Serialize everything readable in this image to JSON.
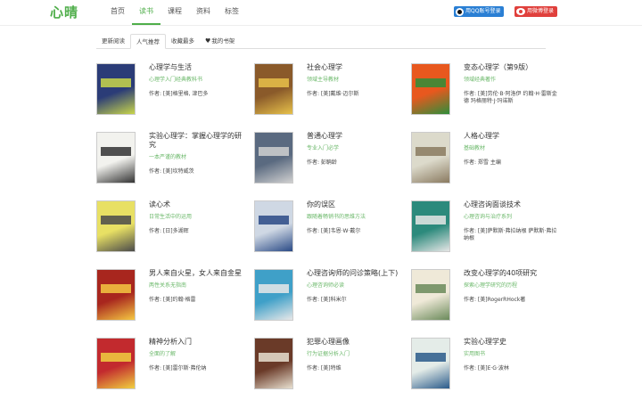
{
  "header": {
    "logo": "心晴",
    "nav": [
      "首页",
      "读书",
      "课程",
      "资料",
      "标签"
    ],
    "active_nav": 1,
    "qq_login": "用QQ账号登录",
    "weibo_login": "用微博登录"
  },
  "tabs": {
    "items": [
      "更新阅读",
      "人气推荐",
      "收藏最多",
      "我的书架"
    ],
    "active": 1
  },
  "books": [
    {
      "title": "心理学与生活",
      "subtitle": "心理学入门经典教科书",
      "author": "作者: [美]格里格, 津巴多",
      "cover": "#2b3c77",
      "accent": "#c9d64a"
    },
    {
      "title": "社会心理学",
      "subtitle": "领域主导教材",
      "author": "作者: [美]戴维·迈尔斯",
      "cover": "#8a5a2a",
      "accent": "#e7c14a"
    },
    {
      "title": "变态心理学（第9版）",
      "subtitle": "领域经典著作",
      "author": "作者: [美]劳伦·B·阿洛伊 约翰·H·雷斯金德 玛格丽特·J·玛诺斯",
      "cover": "#e8581e",
      "accent": "#2e8e3a"
    },
    {
      "title": "实验心理学：掌握心理学的研究",
      "subtitle": "一本严谨的教材",
      "author": "作者: [美]坎特威茨",
      "cover": "#f2f2ee",
      "accent": "#333333"
    },
    {
      "title": "普通心理学",
      "subtitle": "专业入门必学",
      "author": "作者: 彭聃龄",
      "cover": "#5a6a80",
      "accent": "#d0d0d0"
    },
    {
      "title": "人格心理学",
      "subtitle": "基础教材",
      "author": "作者: 郑雪 主编",
      "cover": "#dcdacb",
      "accent": "#8a7a60"
    },
    {
      "title": "读心术",
      "subtitle": "日常生活中的运用",
      "author": "作者: [日]多湖辉",
      "cover": "#e8e064",
      "accent": "#4a4a4a"
    },
    {
      "title": "你的误区",
      "subtitle": "跟随着畅销书的思维方法",
      "author": "作者: [美]韦恩·W·戴尔",
      "cover": "#cfd8e4",
      "accent": "#2a4a86"
    },
    {
      "title": "心理咨询面谈技术",
      "subtitle": "心理咨询与治疗系列",
      "author": "作者: [美]萨默斯·弗拉纳根 萨默斯·弗拉纳根",
      "cover": "#2c8a7c",
      "accent": "#e6e6e6"
    },
    {
      "title": "男人来自火星，女人来自金星",
      "subtitle": "两性关系无指南",
      "author": "作者: [美]约翰·格雷",
      "cover": "#a8261e",
      "accent": "#f5c842"
    },
    {
      "title": "心理咨询师的问诊策略(上下)",
      "subtitle": "心理咨询师必读",
      "author": "作者: [美]科米尔",
      "cover": "#3fa0c8",
      "accent": "#e8e8e8"
    },
    {
      "title": "改变心理学的40项研究",
      "subtitle": "探索心理学研究的历程",
      "author": "作者: [美]RogerRHock著",
      "cover": "#efe9d8",
      "accent": "#6a8a5a"
    },
    {
      "title": "精神分析入门",
      "subtitle": "全面的了解",
      "author": "作者: [美]雷尔斯·弗伦纳",
      "cover": "#c22a2e",
      "accent": "#f0d040"
    },
    {
      "title": "犯罪心理画像",
      "subtitle": "行为证据分析入门",
      "author": "作者: [美]特维",
      "cover": "#6a3a28",
      "accent": "#e8e0d0"
    },
    {
      "title": "实验心理学史",
      "subtitle": "实用图书",
      "author": "作者: [美]E·G·波林",
      "cover": "#e4ece8",
      "accent": "#2a5a8a"
    }
  ]
}
